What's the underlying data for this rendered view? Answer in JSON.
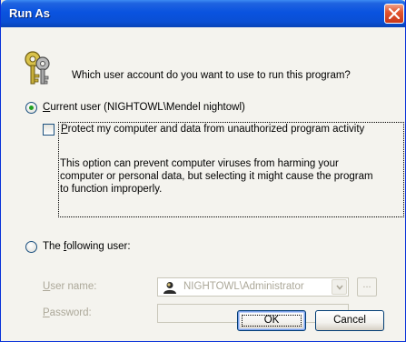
{
  "window": {
    "title": "Run As"
  },
  "prompt": {
    "question": "Which user account do you want to use to run this program?"
  },
  "current_user": {
    "label_prefix": "C",
    "label_rest": "urrent user (NIGHTOWL\\Mendel nightowl)",
    "selected": true
  },
  "protect": {
    "label_prefix": "P",
    "label_rest": "rotect my computer and data from unauthorized program activity",
    "checked": false,
    "description_line1": "This option can prevent computer viruses from harming your",
    "description_line2": "computer or personal data, but selecting it might cause the program",
    "description_line3": "to function improperly."
  },
  "following_user": {
    "label_before": "The ",
    "label_accel": "f",
    "label_after": "ollowing user:",
    "selected": false
  },
  "fields": {
    "username_accel": "U",
    "username_rest": "ser name:",
    "username_value": "NIGHTOWL\\Administrator",
    "password_accel": "P",
    "password_rest": "assword:",
    "password_value": "",
    "browse_label": "..."
  },
  "buttons": {
    "ok": "OK",
    "cancel": "Cancel"
  },
  "colors": {
    "titlebar": "#0a53df",
    "radio_dot": "#21a121",
    "disabled_text": "#aca899"
  },
  "icons": {
    "title_close": "close-icon",
    "prompt": "keys-icon",
    "user": "user-account-icon",
    "dropdown": "chevron-down-icon"
  }
}
